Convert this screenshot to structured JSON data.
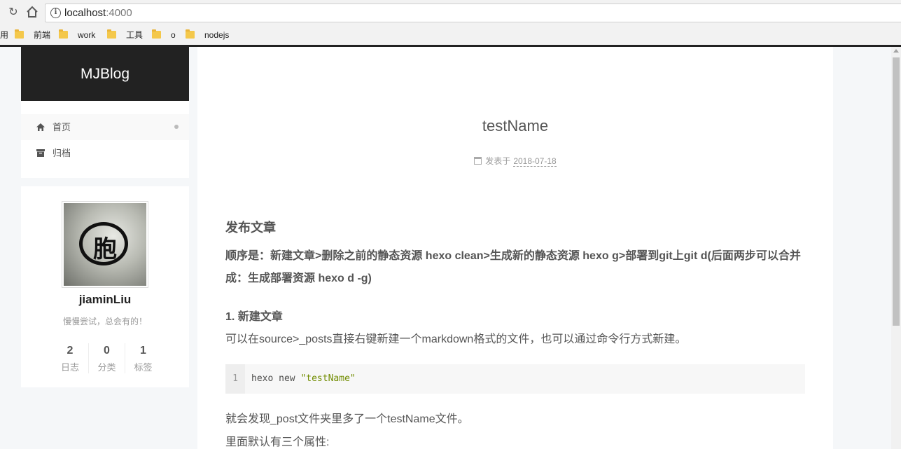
{
  "browser": {
    "url_host": "localhost",
    "url_port": ":4000",
    "bookmarks": [
      {
        "label": "用",
        "folder": false
      },
      {
        "label": "前端",
        "folder": true
      },
      {
        "label": "work",
        "folder": true
      },
      {
        "label": "工具",
        "folder": true
      },
      {
        "label": "o",
        "folder": true
      },
      {
        "label": "nodejs",
        "folder": true
      }
    ]
  },
  "sidebar": {
    "brand": "MJBlog",
    "menu": [
      {
        "label": "首页",
        "icon": "home-icon",
        "active": true
      },
      {
        "label": "归档",
        "icon": "archive-icon",
        "active": false
      }
    ],
    "profile": {
      "name": "jiaminLiu",
      "description": "慢慢尝试，总会有的！",
      "avatar_glyph": "胞",
      "stats": [
        {
          "count": "2",
          "label": "日志"
        },
        {
          "count": "0",
          "label": "分类"
        },
        {
          "count": "1",
          "label": "标签"
        }
      ]
    }
  },
  "post": {
    "title": "testName",
    "meta_prefix": "发表于",
    "date": "2018-07-18",
    "heading": "发布文章",
    "lead": "顺序是：新建文章>删除之前的静态资源 hexo clean>生成新的静态资源 hexo g>部署到git上git d(后面两步可以合并成：生成部署资源 hexo d -g)",
    "step1_title": "1. 新建文章",
    "step1_text": "可以在source>_posts直接右键新建一个markdown格式的文件，也可以通过命令行方式新建。",
    "code": {
      "line_number": "1",
      "command": "hexo new ",
      "string": "\"testName\""
    },
    "after_text": "就会发现_post文件夹里多了一个testName文件。",
    "attrs_text": "里面默认有三个属性:"
  }
}
